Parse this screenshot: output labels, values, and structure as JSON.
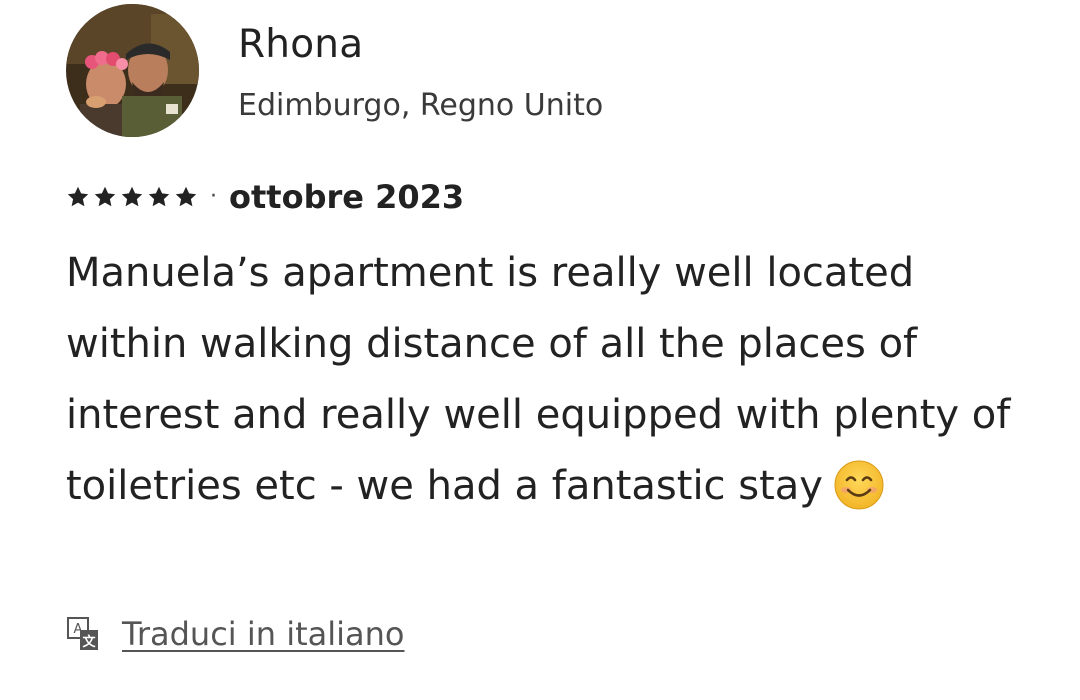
{
  "reviewer": {
    "name": "Rhona",
    "location": "Edimburgo, Regno Unito",
    "avatar_icon": "reviewer-avatar-photo"
  },
  "review": {
    "rating": 5,
    "rating_max": 5,
    "separator": "·",
    "date": "ottobre 2023",
    "text": "Manuela’s apartment is really well located within walking distance of all the places of interest and really well equipped with plenty of toiletries etc - we had a fantastic stay",
    "emoji_icon": "smiling-face-icon"
  },
  "actions": {
    "translate_label": "Traduci in italiano",
    "translate_icon": "translate-icon"
  },
  "colors": {
    "text": "#222222",
    "secondary_text": "#3a3a3a",
    "link": "#555555",
    "star": "#222222",
    "emoji_face": "#f7c331"
  }
}
